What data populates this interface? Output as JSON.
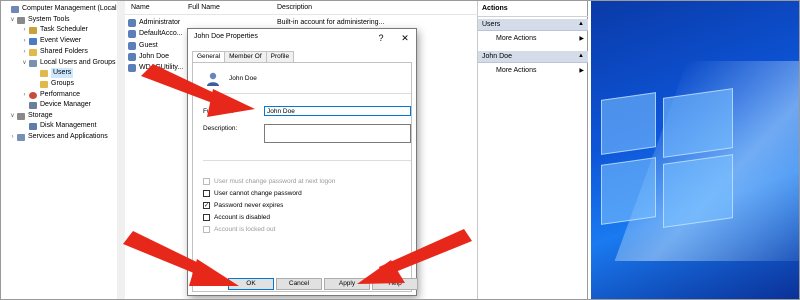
{
  "tree": {
    "items": [
      {
        "label": "Computer Management (Local",
        "caret": "",
        "color": "#6f88b5"
      },
      {
        "label": "System Tools",
        "caret": "∨",
        "color": "#8a8a8a"
      },
      {
        "label": "Task Scheduler",
        "caret": "›",
        "color": "#c9a13a"
      },
      {
        "label": "Event Viewer",
        "caret": "›",
        "color": "#4a7bc4"
      },
      {
        "label": "Shared Folders",
        "caret": "›",
        "color": "#e0b94a"
      },
      {
        "label": "Local Users and Groups",
        "caret": "∨",
        "color": "#7a8fb4"
      },
      {
        "label": "Users",
        "caret": "",
        "color": "#e0b94a"
      },
      {
        "label": "Groups",
        "caret": "",
        "color": "#e0b94a"
      },
      {
        "label": "Performance",
        "caret": "›",
        "color": "#c84b3c"
      },
      {
        "label": "Device Manager",
        "caret": "",
        "color": "#6c7f99"
      },
      {
        "label": "Storage",
        "caret": "∨",
        "color": "#8a8a8a"
      },
      {
        "label": "Disk Management",
        "caret": "",
        "color": "#5f7fa8"
      },
      {
        "label": "Services and Applications",
        "caret": "›",
        "color": "#7a8fb4"
      }
    ]
  },
  "list": {
    "columns": [
      "Name",
      "Full Name",
      "Description"
    ],
    "rows": [
      {
        "name": "Administrator",
        "description": "Built-in account for administering..."
      },
      {
        "name": "DefaultAcco...",
        "description": ""
      },
      {
        "name": "Guest",
        "description": ""
      },
      {
        "name": "John Doe",
        "description": ""
      },
      {
        "name": "WDAGUtility...",
        "description": ""
      }
    ]
  },
  "actions": {
    "title": "Actions",
    "sections": [
      {
        "header": "Users",
        "item": "More Actions"
      },
      {
        "header": "John Doe",
        "item": "More Actions"
      }
    ]
  },
  "dialog": {
    "title": "John Doe Properties",
    "help_glyph": "?",
    "close_glyph": "✕",
    "tabs": [
      "General",
      "Member Of",
      "Profile"
    ],
    "user_display": "John Doe",
    "full_name_label": "Full name:",
    "full_name_value": "John Doe",
    "description_label": "Description:",
    "description_value": "",
    "checkboxes": [
      {
        "label": "User must change password at next logon",
        "checked": false,
        "disabled": true
      },
      {
        "label": "User cannot change password",
        "checked": false,
        "disabled": false
      },
      {
        "label": "Password never expires",
        "checked": true,
        "disabled": false
      },
      {
        "label": "Account is disabled",
        "checked": false,
        "disabled": false
      },
      {
        "label": "Account is locked out",
        "checked": false,
        "disabled": true
      }
    ],
    "buttons": {
      "ok": "OK",
      "cancel": "Cancel",
      "apply": "Apply",
      "help": "Help"
    }
  },
  "icons": {
    "expand": "chevron-right-icon",
    "collapse": "chevron-down-icon",
    "submenu": "triangle-right-icon",
    "collapse_section": "triangle-up-icon"
  },
  "colors": {
    "arrow": "#e8271b",
    "selection": "#cde8ff",
    "action_header": "#d4dcea",
    "focus": "#0078d7"
  }
}
